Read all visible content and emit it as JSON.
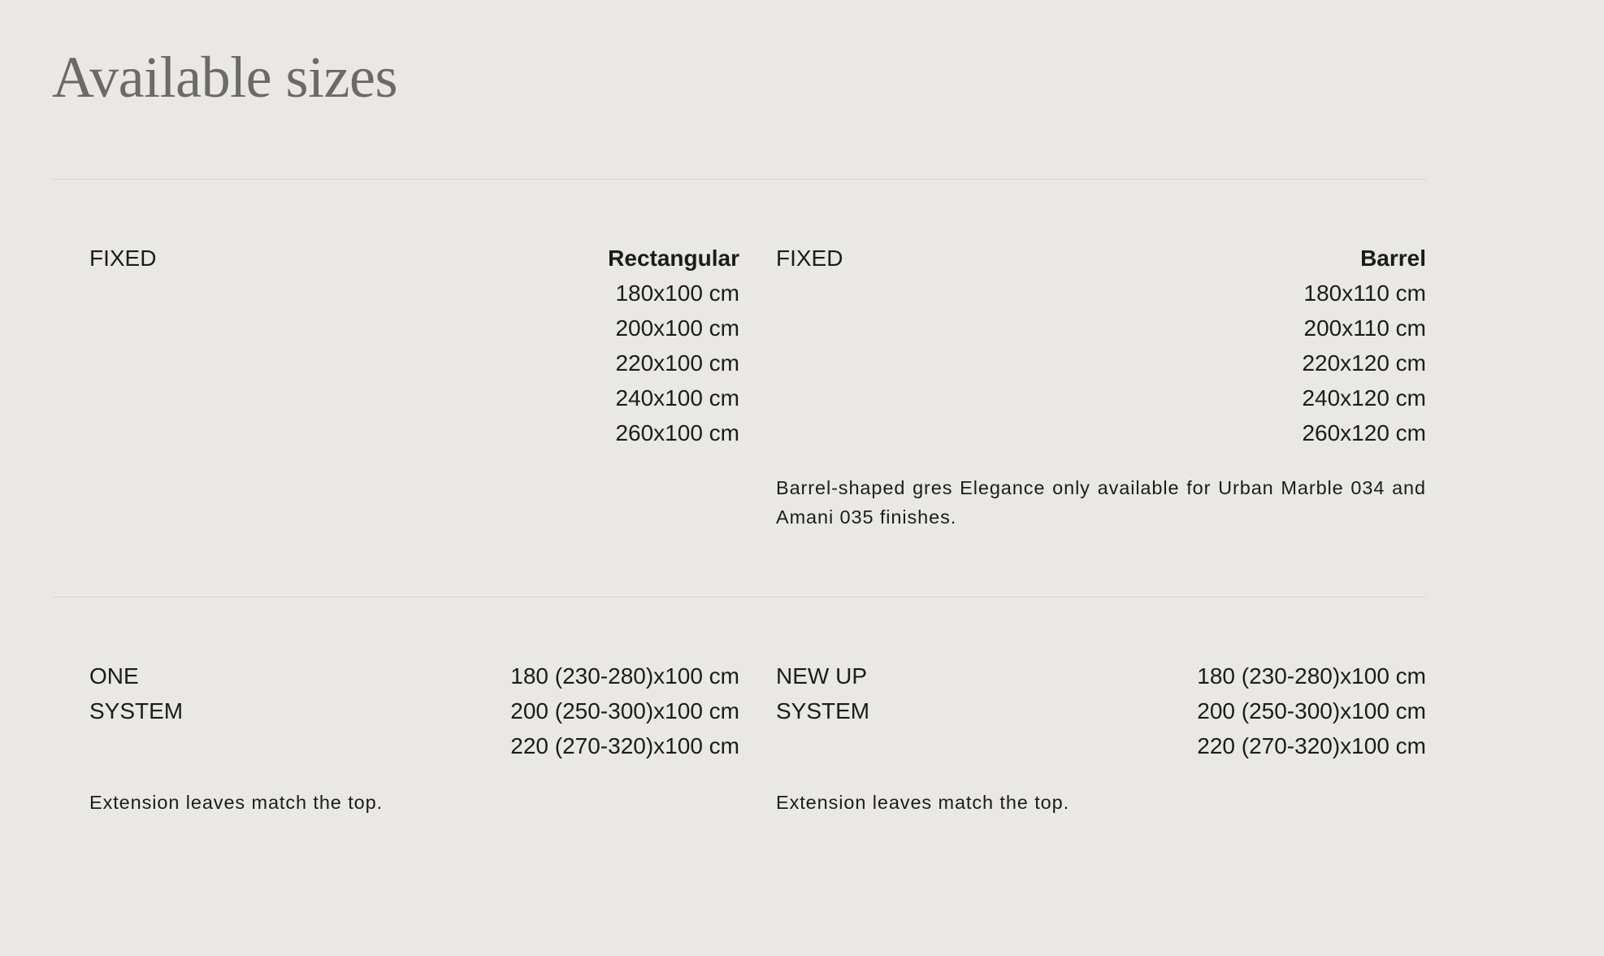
{
  "page_title": "Available sizes",
  "sections": [
    {
      "label": "FIXED",
      "type_label": "Rectangular",
      "sizes": [
        "180x100 cm",
        "200x100 cm",
        "220x100 cm",
        "240x100 cm",
        "260x100 cm"
      ],
      "note": ""
    },
    {
      "label": "FIXED",
      "type_label": "Barrel",
      "sizes": [
        "180x110 cm",
        "200x110 cm",
        "220x120 cm",
        "240x120 cm",
        "260x120 cm"
      ],
      "note": "Barrel-shaped gres Elegance only available for Urban Marble 034 and Amani 035 finishes."
    },
    {
      "label_lines": [
        "ONE",
        "SYSTEM"
      ],
      "sizes": [
        "180 (230-280)x100 cm",
        "200 (250-300)x100 cm",
        "220 (270-320)x100 cm"
      ],
      "note": "Extension leaves match the top."
    },
    {
      "label_lines": [
        "NEW UP",
        "SYSTEM"
      ],
      "sizes": [
        "180 (230-280)x100 cm",
        "200 (250-300)x100 cm",
        "220 (270-320)x100 cm"
      ],
      "note": "Extension leaves match the top."
    }
  ],
  "colors": {
    "background": "#e9e8e4",
    "title": "#6b6a67",
    "text": "#1c1c1c",
    "divider": "#d7d6d1"
  }
}
